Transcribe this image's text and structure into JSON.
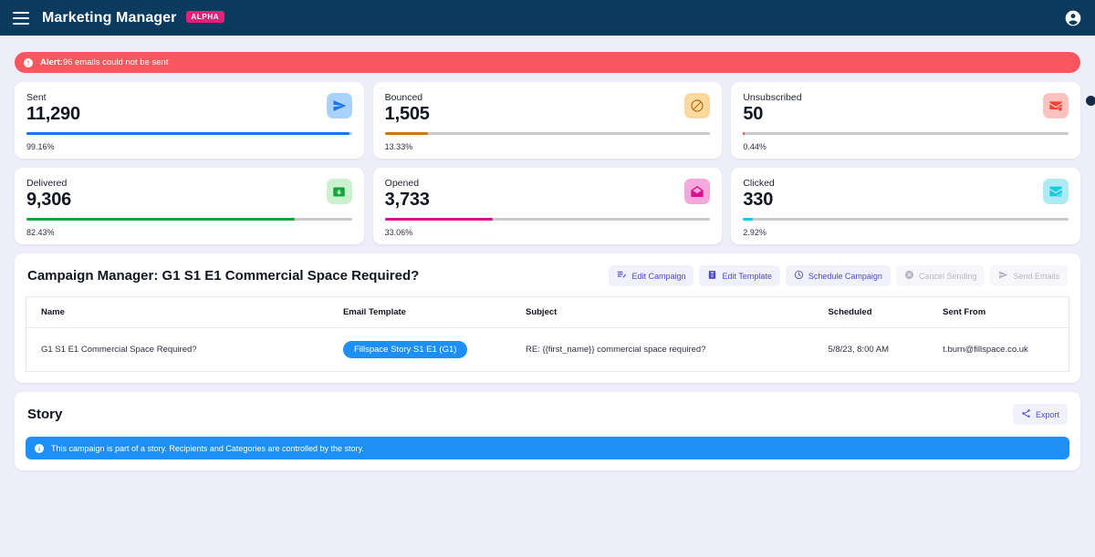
{
  "appbar": {
    "menu_icon": "hamburger-icon",
    "title": "Marketing Manager",
    "badge": "ALPHA",
    "account_icon": "account-circle-icon"
  },
  "alert": {
    "icon": "error-icon",
    "label": "Alert:",
    "message": " 96 emails could not be sent",
    "color": "#f9565f"
  },
  "stats": [
    {
      "label": "Sent",
      "value": "11,290",
      "percent_label": "99.16%",
      "percent": 99.16,
      "icon": "send-icon",
      "bar_color": "#1a73e8",
      "icon_bg": "#a8d2fb",
      "icon_color": "#1a73e8"
    },
    {
      "label": "Bounced",
      "value": "1,505",
      "percent_label": "13.33%",
      "percent": 13.33,
      "icon": "block-icon",
      "bar_color": "#c9770a",
      "icon_bg": "#fbd9a0",
      "icon_color": "#c9770a"
    },
    {
      "label": "Unsubscribed",
      "value": "50",
      "percent_label": "0.44%",
      "percent": 0.44,
      "icon": "unsubscribe-icon",
      "bar_color": "#f44336",
      "icon_bg": "#fbc2bf",
      "icon_color": "#f44336"
    },
    {
      "label": "Delivered",
      "value": "9,306",
      "percent_label": "82.43%",
      "percent": 82.43,
      "icon": "mark-email-read-icon",
      "bar_color": "#12a53b",
      "icon_bg": "#caf2ce",
      "icon_color": "#12a53b"
    },
    {
      "label": "Opened",
      "value": "3,733",
      "percent_label": "33.06%",
      "percent": 33.06,
      "icon": "drafts-icon",
      "bar_color": "#d6128e",
      "icon_bg": "#f4a8dc",
      "icon_color": "#d6128e"
    },
    {
      "label": "Clicked",
      "value": "330",
      "percent_label": "2.92%",
      "percent": 2.92,
      "icon": "mark-email-click-icon",
      "bar_color": "#19c9dd",
      "icon_bg": "#aeeaf4",
      "icon_color": "#19c9dd"
    }
  ],
  "campaign_panel": {
    "title": "Campaign Manager: G1 S1 E1 Commercial Space Required?",
    "actions": [
      {
        "label": "Edit Campaign",
        "icon": "edit-note-icon",
        "disabled": false
      },
      {
        "label": "Edit Template",
        "icon": "edit-document-icon",
        "disabled": false
      },
      {
        "label": "Schedule Campaign",
        "icon": "clock-icon",
        "disabled": false
      },
      {
        "label": "Cancel Sending",
        "icon": "cancel-icon",
        "disabled": true
      },
      {
        "label": "Send Emails",
        "icon": "send-icon",
        "disabled": true
      }
    ],
    "table": {
      "columns": [
        "Name",
        "Email Template",
        "Subject",
        "Scheduled",
        "Sent From"
      ],
      "rows": [
        {
          "name": "G1 S1 E1 Commercial Space Required?",
          "email_template": "Fillspace Story S1 E1 (G1)",
          "subject": "RE: {{first_name}} commercial space required?",
          "scheduled": "5/8/23, 8:00 AM",
          "sent_from": "t.burn@fillspace.co.uk"
        }
      ]
    }
  },
  "story_panel": {
    "title": "Story",
    "export_button": {
      "label": "Export",
      "icon": "share-icon"
    },
    "info": {
      "icon": "info-icon",
      "message": "This campaign is part of a story. Recipients and Categories are controlled by the story.",
      "color": "#1e90f5"
    }
  }
}
